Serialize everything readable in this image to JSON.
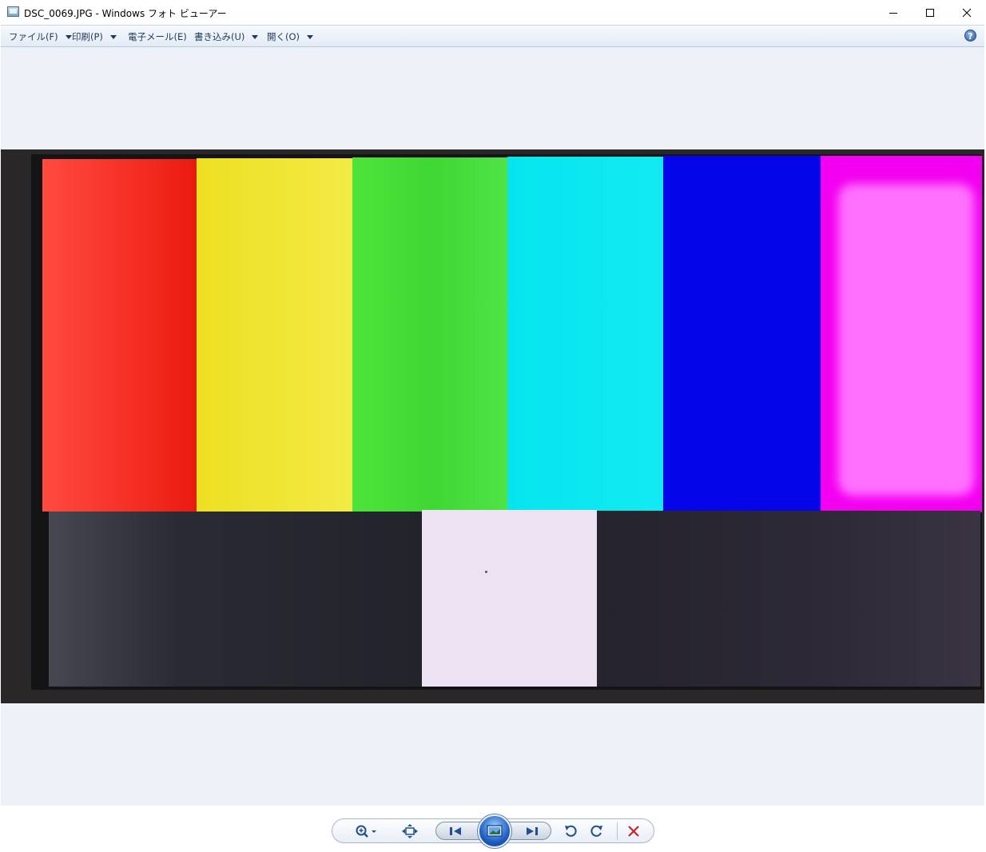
{
  "window": {
    "title": "DSC_0069.JPG - Windows フォト ビューアー",
    "icon": "photo-viewer-icon",
    "controls": [
      "minimize-icon",
      "maximize-icon",
      "close-icon"
    ]
  },
  "menu": {
    "items": [
      {
        "label": "ファイル(F)",
        "has_dropdown": true
      },
      {
        "label": "印刷(P)",
        "has_dropdown": true
      },
      {
        "label": "電子メール(E)",
        "has_dropdown": false
      },
      {
        "label": "書き込み(U)",
        "has_dropdown": true
      },
      {
        "label": "開く(O)",
        "has_dropdown": true
      }
    ],
    "help_glyph": "?"
  },
  "photo": {
    "color_bars": [
      "#f2291e",
      "#f0e02e",
      "#45dc35",
      "#07e7ef",
      "#0505ea",
      "#ff4dff"
    ],
    "lower_colors": [
      "#2b2b35",
      "#ece2f2",
      "#2c2936"
    ]
  },
  "toolbar": {
    "buttons": [
      "zoom-icon",
      "actual-size-icon",
      "previous-icon",
      "slideshow-icon",
      "next-icon",
      "rotate-counterclockwise-icon",
      "rotate-clockwise-icon",
      "delete-icon"
    ]
  },
  "colors": {
    "viewer_background": "#edf1f8",
    "menu_text": "#1e395b",
    "delete_red": "#c0262d"
  }
}
